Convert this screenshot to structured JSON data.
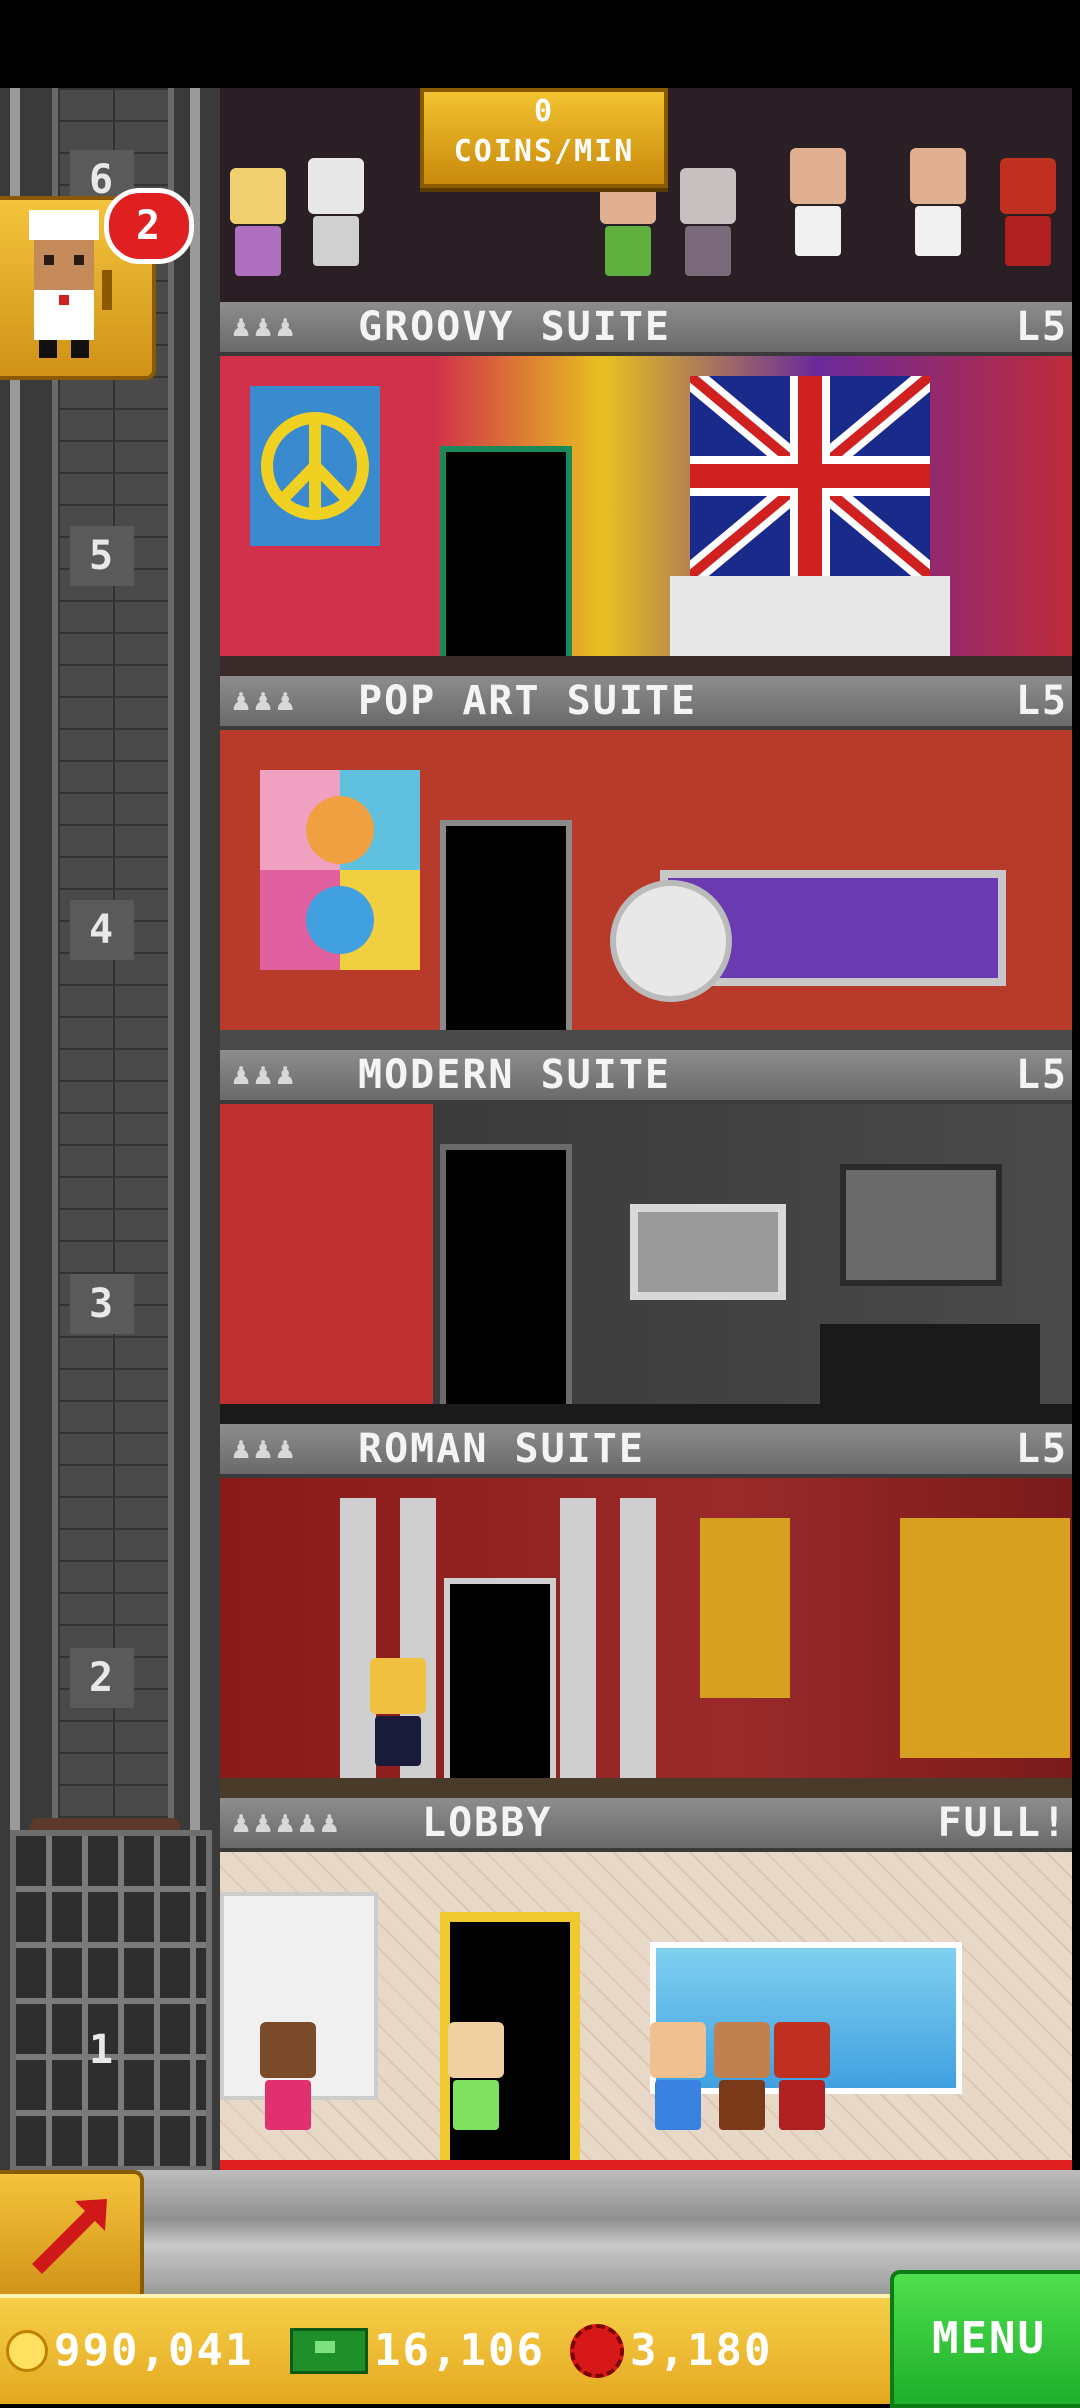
{
  "hud": {
    "coins_per_min_value": "0",
    "coins_per_min_label": "COINS/MIN",
    "notification_count": "2"
  },
  "shaft": {
    "floor_numbers": [
      "6",
      "5",
      "4",
      "3",
      "2",
      "1"
    ]
  },
  "floors": [
    {
      "id": "groovy",
      "name": "GROOVY SUITE",
      "level": "L5",
      "people": "♟♟♟"
    },
    {
      "id": "popart",
      "name": "POP ART SUITE",
      "level": "L5",
      "people": "♟♟♟"
    },
    {
      "id": "modern",
      "name": "MODERN SUITE",
      "level": "L5",
      "people": "♟♟♟"
    },
    {
      "id": "roman",
      "name": "ROMAN SUITE",
      "level": "L5",
      "people": "♟♟♟"
    },
    {
      "id": "lobby",
      "name": "LOBBY",
      "level": "FULL!",
      "people": "♟♟♟♟♟"
    }
  ],
  "currency": {
    "coins": "990,041",
    "bux_cash": "16,106",
    "tokens": "3,180"
  },
  "menu": {
    "label": "MENU"
  },
  "colors": {
    "gold": "#e4a820",
    "menu_green": "#1fae2a",
    "badge_red": "#e02020"
  },
  "icons": [
    "chef-icon",
    "build-arrow-icon",
    "coin-icon",
    "cash-icon",
    "bux-icon"
  ]
}
